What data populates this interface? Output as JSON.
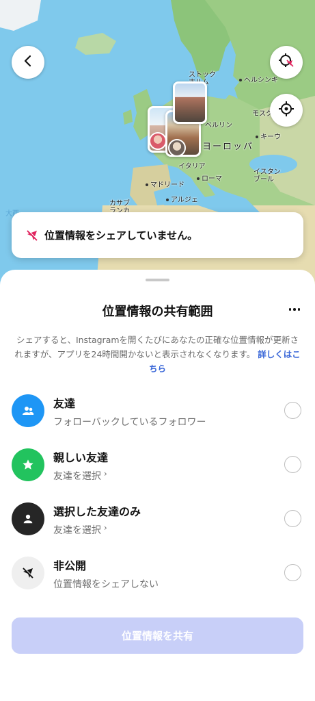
{
  "map": {
    "labels": {
      "stockholm": "ストック\nホルム",
      "helsinki": "ヘルシンキ",
      "moscow": "モスク",
      "berlin": "ベルリン",
      "kyiv": "キーウ",
      "europe": "ヨーロッパ",
      "italy": "イタリア",
      "madrid": "マドリード",
      "rome": "ローマ",
      "istanbul": "イスタン\nブール",
      "casablanca": "カサブ\nランカ",
      "algiers": "アルジェ",
      "atlantic": "大西"
    },
    "buttons": {
      "back_icon": "chevron-left-icon",
      "ghost_icon": "location-off-icon",
      "locate_icon": "crosshair-icon"
    }
  },
  "toast": {
    "text": "位置情報をシェアしていません。",
    "icon": "location-off-icon"
  },
  "sheet": {
    "title": "位置情報の共有範囲",
    "description": "シェアすると、Instagramを開くたびにあなたの正確な位置情報が更新されますが、アプリを24時間開かないと表示されなくなります。",
    "link": "詳しくはこちら",
    "options": [
      {
        "title": "友達",
        "subtitle": "フォローバックしているフォロワー",
        "icon": "friends-icon",
        "color": "#1e96f5",
        "selected": false
      },
      {
        "title": "親しい友達",
        "subtitle": "友達を選択",
        "icon": "star-icon",
        "color": "#22c35e",
        "selected": false
      },
      {
        "title": "選択した友達のみ",
        "subtitle": "友達を選択",
        "icon": "person-icon",
        "color": "#262626",
        "selected": false
      },
      {
        "title": "非公開",
        "subtitle": "位置情報をシェアしない",
        "icon": "location-off-icon",
        "color": "#efefef",
        "selected": false
      }
    ],
    "share_button": "位置情報を共有"
  }
}
